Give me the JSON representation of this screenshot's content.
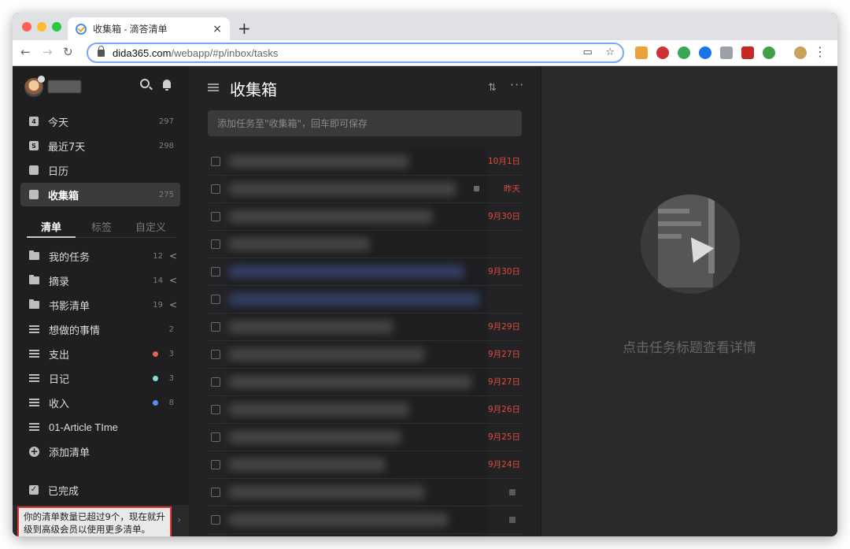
{
  "browser": {
    "tab_title": "收集箱 - 滴答清单",
    "tab_close": "×",
    "new_tab": "+",
    "url_host": "dida365.com",
    "url_path": "/webapp/#p/inbox/tasks",
    "traffic_colors": [
      "#ff5f57",
      "#febc2e",
      "#28c840"
    ],
    "extension_colors": [
      "#e8a33d",
      "#cc3333",
      "#3aa757",
      "#1a73e8",
      "#9aa0a6",
      "#c62828",
      "#43a047",
      "#c9a15a"
    ]
  },
  "sidebar": {
    "nav": [
      {
        "icon": "calendar-today-icon",
        "glyph": "4",
        "label": "今天",
        "count": "297"
      },
      {
        "icon": "calendar-week-icon",
        "glyph": "S",
        "label": "最近7天",
        "count": "298"
      },
      {
        "icon": "calendar-grid-icon",
        "glyph": "",
        "label": "日历",
        "count": ""
      },
      {
        "icon": "inbox-icon",
        "glyph": "",
        "label": "收集箱",
        "count": "275"
      }
    ],
    "tabs": [
      "清单",
      "标签",
      "自定义"
    ],
    "lists": [
      {
        "type": "folder",
        "label": "我的任务",
        "count": "12",
        "chevron": "<"
      },
      {
        "type": "folder",
        "label": "摘录",
        "count": "14",
        "chevron": "<"
      },
      {
        "type": "folder",
        "label": "书影清单",
        "count": "19",
        "chevron": "<"
      },
      {
        "type": "list",
        "label": "想做的事情",
        "count": "2"
      },
      {
        "type": "list",
        "label": "支出",
        "count": "3",
        "dot": "#e5605a"
      },
      {
        "type": "list",
        "label": "日记",
        "count": "3",
        "dot": "#7fe0d8"
      },
      {
        "type": "list",
        "label": "收入",
        "count": "8",
        "dot": "#5a8ff0"
      },
      {
        "type": "filter",
        "label": "01-Article TIme",
        "count": ""
      }
    ],
    "add_list": "添加清单",
    "completed": "已完成",
    "upgrade_text": "你的清单数量已超过9个，现在就升级到高级会员以使用更多清单。",
    "upgrade_arrow": "›"
  },
  "main": {
    "title": "收集箱",
    "more": "···",
    "add_placeholder": "添加任务至\"收集箱\"，回车即可保存",
    "tasks": [
      {
        "date": "10月1日"
      },
      {
        "date": "昨天"
      },
      {
        "date": "9月30日"
      },
      {
        "date": ""
      },
      {
        "date": "9月30日"
      },
      {
        "date": ""
      },
      {
        "date": "9月29日"
      },
      {
        "date": "9月27日"
      },
      {
        "date": "9月27日"
      },
      {
        "date": "9月26日"
      },
      {
        "date": "9月25日"
      },
      {
        "date": "9月24日"
      },
      {
        "date": ""
      },
      {
        "date": ""
      }
    ]
  },
  "detail": {
    "empty_text": "点击任务标题查看详情"
  }
}
